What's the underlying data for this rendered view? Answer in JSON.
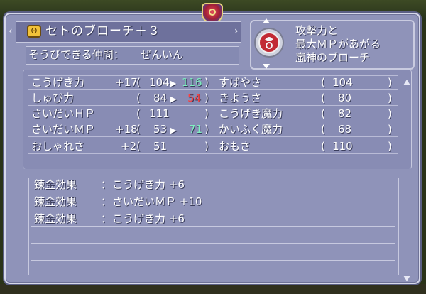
{
  "item": {
    "name": "セトのブローチ＋３",
    "icon": "brooch-icon"
  },
  "equip": {
    "label": "そうびできる仲間：",
    "value": "ぜんいん"
  },
  "description": {
    "lines": [
      "攻撃力と",
      "最大ＭＰがあがる",
      "嵐神のブローチ"
    ]
  },
  "stats": {
    "left": [
      {
        "name": "こうげき力",
        "bonus": "+17",
        "before": "104",
        "after": "116",
        "after_color": "green"
      },
      {
        "name": "しゅび力",
        "bonus": "",
        "before": "84",
        "after": "54",
        "after_color": "red"
      },
      {
        "name": "さいだいＨＰ",
        "bonus": "",
        "before": "111",
        "after": "",
        "after_color": ""
      },
      {
        "name": "さいだいＭＰ",
        "bonus": "+18",
        "before": "53",
        "after": "71",
        "after_color": "green"
      },
      {
        "name": "おしゃれさ",
        "bonus": "+2",
        "before": "51",
        "after": "",
        "after_color": ""
      }
    ],
    "right": [
      {
        "name": "すばやさ",
        "value": "104"
      },
      {
        "name": "きようさ",
        "value": "80"
      },
      {
        "name": "こうげき魔力",
        "value": "82"
      },
      {
        "name": "かいふく魔力",
        "value": "68"
      },
      {
        "name": "おもさ",
        "value": "110"
      }
    ]
  },
  "alchemy": [
    {
      "label": "錬金効果",
      "sep": "：",
      "effect": "こうげき力 +6"
    },
    {
      "label": "錬金効果",
      "sep": "：",
      "effect": "さいだいＭＰ +10"
    },
    {
      "label": "錬金効果",
      "sep": "：",
      "effect": "こうげき力 +6"
    }
  ],
  "colors": {
    "panel": "#8f93b9",
    "gain": "#7ff0c0",
    "loss": "#ff4040"
  }
}
